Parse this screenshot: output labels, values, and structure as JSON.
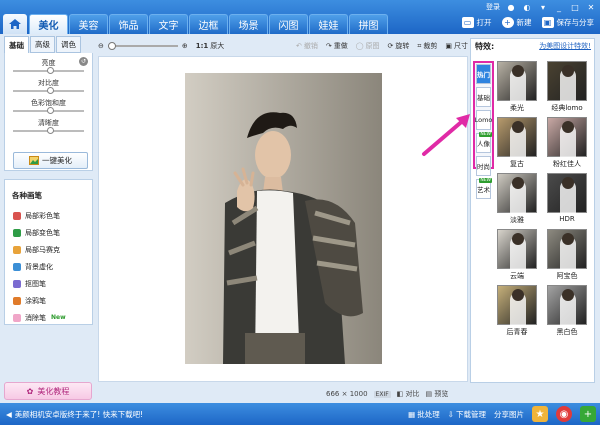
{
  "window": {
    "login": "登录"
  },
  "header_actions": {
    "open": "打开",
    "new": "新建",
    "save": "保存与分享"
  },
  "tabs": [
    "美化",
    "美容",
    "饰品",
    "文字",
    "边框",
    "场景",
    "闪图",
    "娃娃",
    "拼图"
  ],
  "left": {
    "subtabs": [
      "基础",
      "高级",
      "调色"
    ],
    "sliders": [
      "亮度",
      "对比度",
      "色彩饱和度",
      "清晰度"
    ],
    "one_key": "一键美化",
    "brushes_title": "各种画笔",
    "brushes": [
      {
        "label": "局部彩色笔",
        "color": "#d9534f"
      },
      {
        "label": "局部变色笔",
        "color": "#2e9c46"
      },
      {
        "label": "局部马赛克",
        "color": "#e8a33a"
      },
      {
        "label": "背景虚化",
        "color": "#3b8fd6"
      },
      {
        "label": "抠图笔",
        "color": "#7b6bd1"
      },
      {
        "label": "涂鸦笔",
        "color": "#e07b2a"
      },
      {
        "label": "消除笔",
        "color": "#f0a6c8"
      }
    ],
    "new_tag": "New",
    "tutorial": "美化教程"
  },
  "toolbar": {
    "ratio": "1:1",
    "original": "原大",
    "undo": "撤销",
    "redo": "重做",
    "origin": "原图",
    "rotate": "旋转",
    "crop": "裁剪",
    "size": "尺寸"
  },
  "canvas": {
    "width": "666",
    "x": "×",
    "height": "1000",
    "exif": "EXIF",
    "compare": "对比",
    "preview": "预览"
  },
  "effects": {
    "title": "特效:",
    "link": "为美图设计特效!",
    "categories": [
      {
        "label": "热门",
        "active": true,
        "hot": ""
      },
      {
        "label": "基础",
        "active": false,
        "hot": ""
      },
      {
        "label": "Lomo",
        "active": false,
        "hot": ""
      },
      {
        "label": "人像",
        "active": false,
        "hot": "NEW"
      },
      {
        "label": "时尚",
        "active": false,
        "hot": ""
      },
      {
        "label": "艺术",
        "active": false,
        "hot": "NEW"
      }
    ],
    "items": [
      {
        "label": "柔光",
        "tone": "#b8b1a4"
      },
      {
        "label": "经典lomo",
        "tone": "#4a4231"
      },
      {
        "label": "复古",
        "tone": "#b89b6d"
      },
      {
        "label": "粉红佳人",
        "tone": "#c9a9a5"
      },
      {
        "label": "淡雅",
        "tone": "#cfcbc2"
      },
      {
        "label": "HDR",
        "tone": "#4b4b4b"
      },
      {
        "label": "云端",
        "tone": "#d8d4cc"
      },
      {
        "label": "阿宝色",
        "tone": "#8d8a80"
      },
      {
        "label": "后青春",
        "tone": "#c6b07a"
      },
      {
        "label": "黑白色",
        "tone": "#a3a3a3"
      }
    ]
  },
  "footer": {
    "news": "美颜相机安卓版终于来了! 快来下载吧!",
    "batch": "批处理",
    "download": "下载管理",
    "share": "分享图片"
  }
}
